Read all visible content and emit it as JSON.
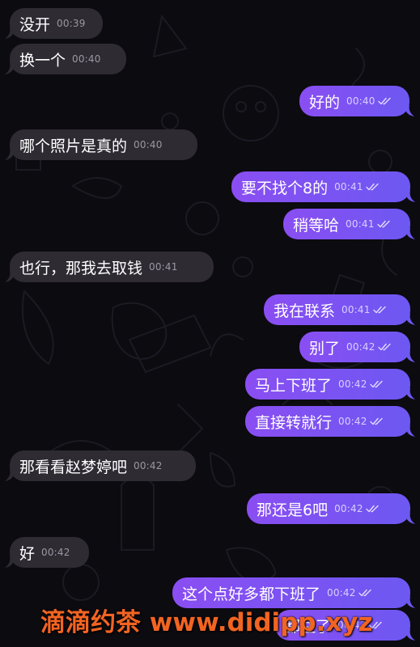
{
  "colors": {
    "background": "#0c0b10",
    "incoming_bubble": "#2e2b33",
    "outgoing_gradient_start": "#8a4ef2",
    "outgoing_gradient_end": "#6d58f2",
    "watermark": "#f26422"
  },
  "messages": [
    {
      "side": "in",
      "text": "没开",
      "time": "00:39",
      "read": false
    },
    {
      "side": "in",
      "text": "换一个",
      "time": "00:40",
      "read": false
    },
    {
      "side": "out",
      "text": "好的",
      "time": "00:40",
      "read": true
    },
    {
      "side": "in",
      "text": "哪个照片是真的",
      "time": "00:40",
      "read": false
    },
    {
      "side": "out",
      "text": "要不找个8的",
      "time": "00:41",
      "read": true
    },
    {
      "side": "out",
      "text": "稍等哈",
      "time": "00:41",
      "read": true
    },
    {
      "side": "in",
      "text": "也行，那我去取钱",
      "time": "00:41",
      "read": false
    },
    {
      "side": "out",
      "text": "我在联系",
      "time": "00:41",
      "read": true
    },
    {
      "side": "out",
      "text": "别了",
      "time": "00:42",
      "read": true
    },
    {
      "side": "out",
      "text": "马上下班了",
      "time": "00:42",
      "read": true
    },
    {
      "side": "out",
      "text": "直接转就行",
      "time": "00:42",
      "read": true
    },
    {
      "side": "in",
      "text": "那看看赵梦婷吧",
      "time": "00:42",
      "read": false
    },
    {
      "side": "out",
      "text": "那还是6吧",
      "time": "00:42",
      "read": true
    },
    {
      "side": "in",
      "text": "好",
      "time": "00:42",
      "read": false
    },
    {
      "side": "out",
      "text": "这个点好多都下班了",
      "time": "00:42",
      "read": true
    },
    {
      "side": "out",
      "text": "都住了",
      "time": "00:43",
      "read": true
    }
  ],
  "watermark": "滴滴约茶 www.didipp.xyz"
}
